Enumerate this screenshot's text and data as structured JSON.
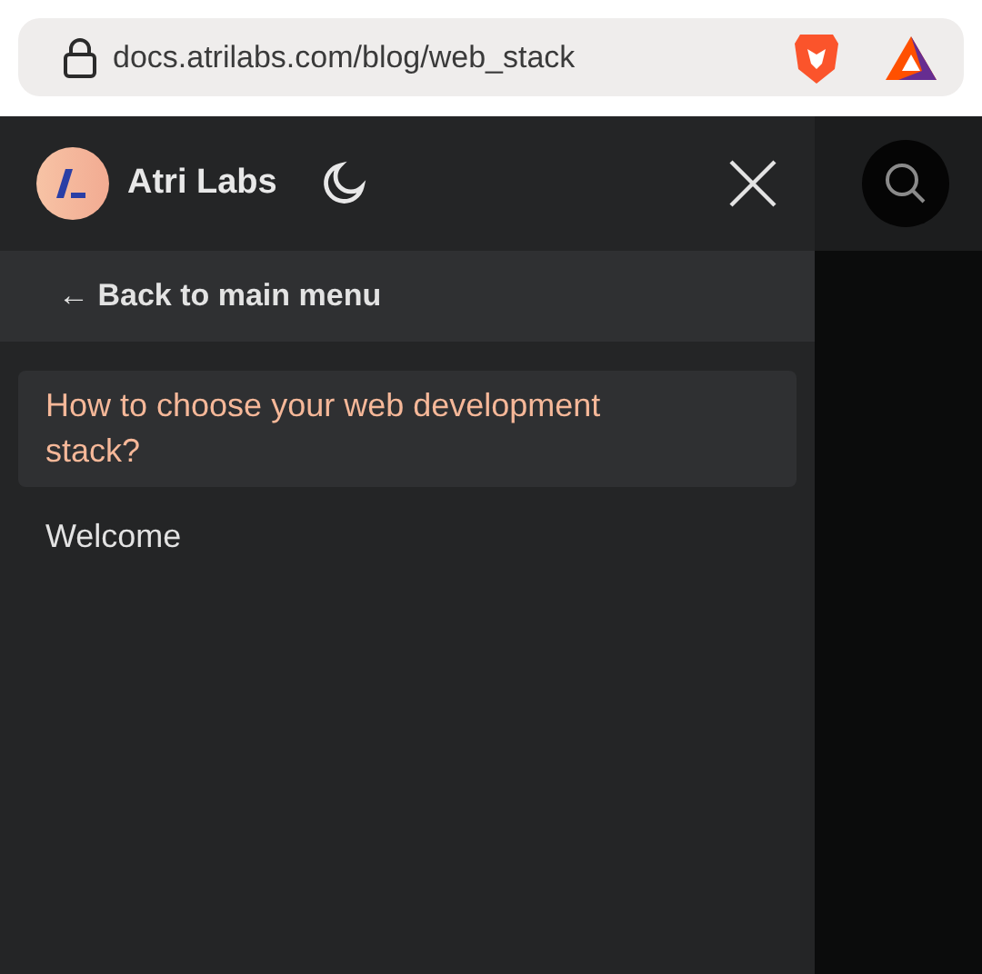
{
  "address_bar": {
    "url": "docs.atrilabs.com/blog/web_stack"
  },
  "sidebar": {
    "brand": "Atri Labs",
    "back_link": "← Back to main menu",
    "items": [
      {
        "label": "How to choose your web development stack?",
        "selected": true
      },
      {
        "label": "Welcome",
        "selected": false
      }
    ]
  }
}
